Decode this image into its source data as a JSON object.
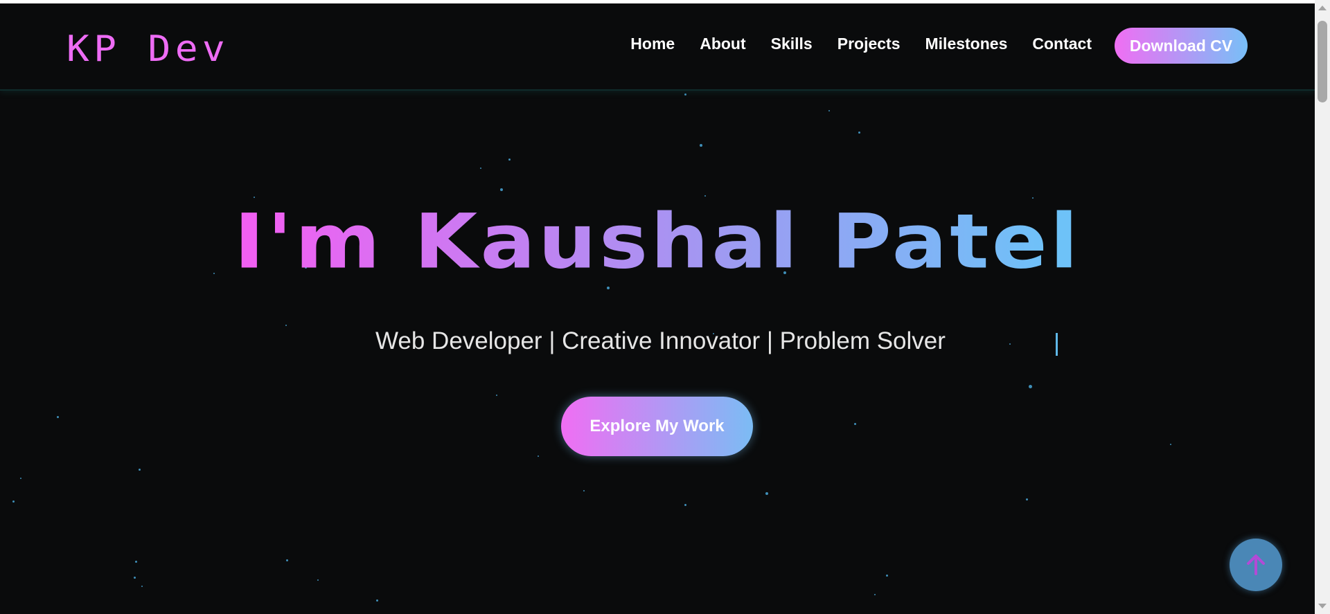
{
  "navbar": {
    "logo": "KP Dev",
    "links": [
      "Home",
      "About",
      "Skills",
      "Projects",
      "Milestones",
      "Contact"
    ],
    "cv_button": "Download CV"
  },
  "hero": {
    "title": "I'm Kaushal Patel",
    "subtitle": "Web Developer | Creative Innovator | Problem Solver",
    "cta": "Explore My Work"
  },
  "icons": {
    "scroll_top": "arrow-up-icon"
  },
  "colors": {
    "background": "#0a0b0c",
    "accent_pink": "#f06ef3",
    "accent_blue": "#78bff7",
    "scroll_top_bg": "#4a87b6",
    "arrow": "#b34ad6"
  }
}
